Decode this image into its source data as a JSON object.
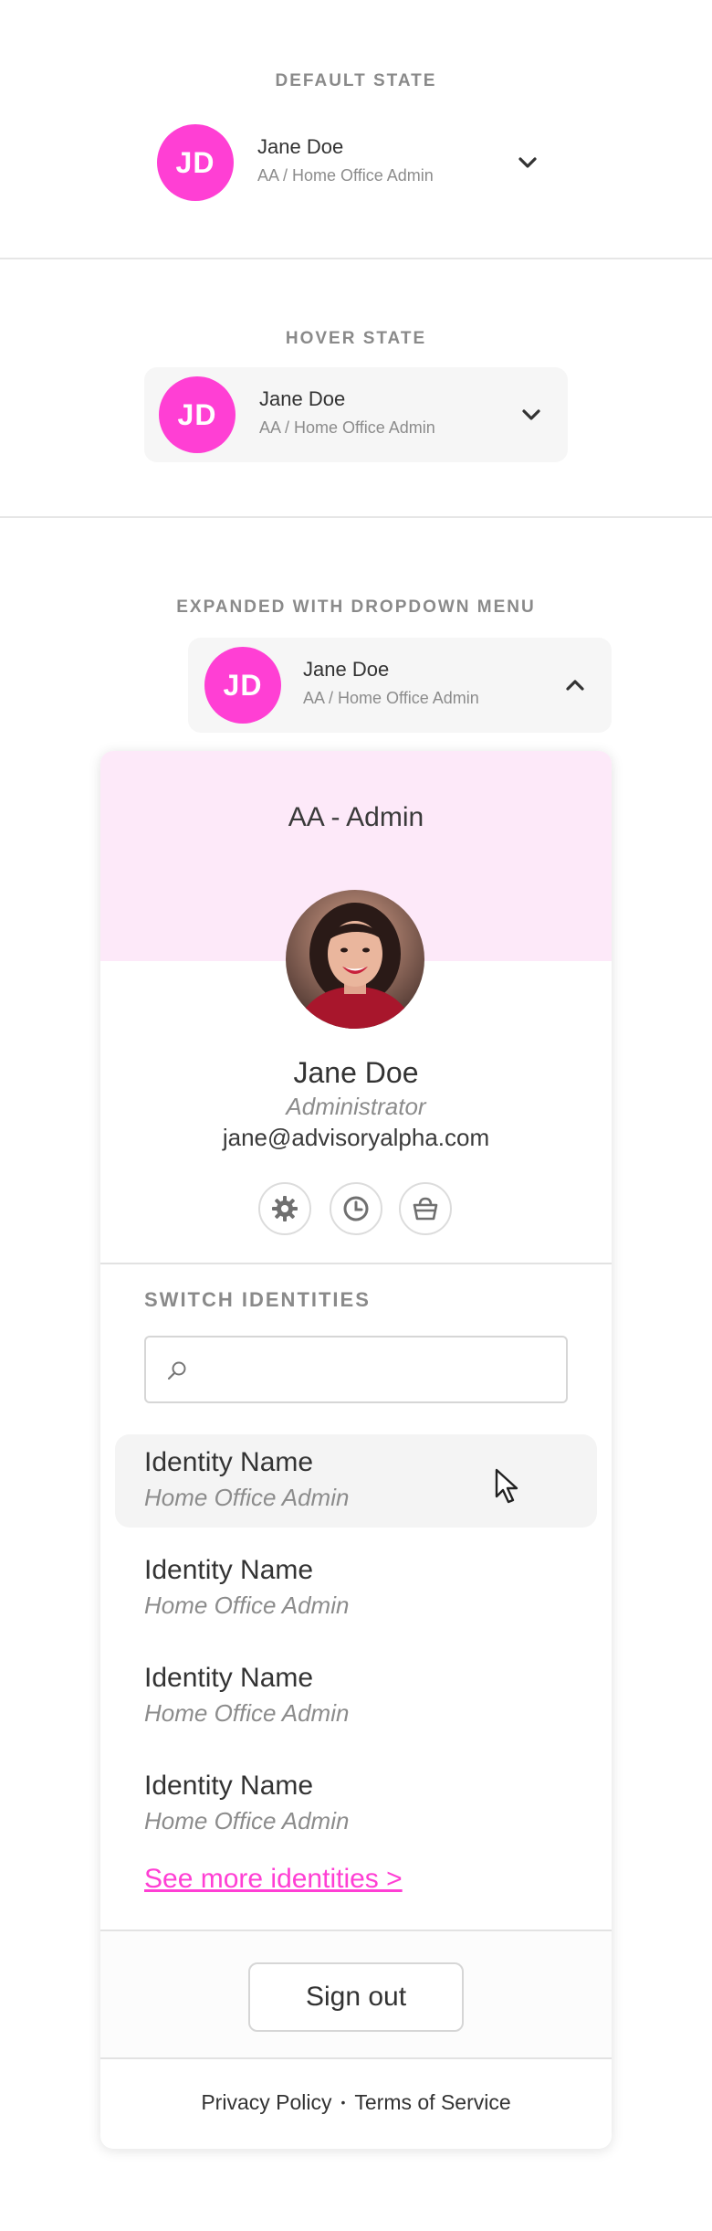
{
  "states": {
    "default_label": "DEFAULT STATE",
    "hover_label": "HOVER STATE",
    "expanded_label": "EXPANDED WITH DROPDOWN MENU"
  },
  "user": {
    "initials": "JD",
    "name": "Jane Doe",
    "role_line": "AA / Home Office Admin"
  },
  "dropdown": {
    "org_title": "AA - Admin",
    "profile_name": "Jane Doe",
    "profile_title": "Administrator",
    "profile_email": "jane@advisoryalpha.com",
    "icon_buttons": [
      "gear-icon",
      "clock-icon",
      "basket-icon"
    ],
    "switch_label": "SWITCH IDENTITIES",
    "search_placeholder": "",
    "identities": [
      {
        "name": "Identity Name",
        "role": "Home Office Admin"
      },
      {
        "name": "Identity Name",
        "role": "Home Office Admin"
      },
      {
        "name": "Identity Name",
        "role": "Home Office Admin"
      },
      {
        "name": "Identity Name",
        "role": "Home Office Admin"
      }
    ],
    "see_more": "See more identities >",
    "sign_out": "Sign out",
    "privacy": "Privacy Policy",
    "separator": "•",
    "terms": "Terms of Service"
  },
  "colors": {
    "accent": "#ff3fd4",
    "header_tint": "#fde9f9",
    "hover_bg": "#f6f6f6"
  }
}
